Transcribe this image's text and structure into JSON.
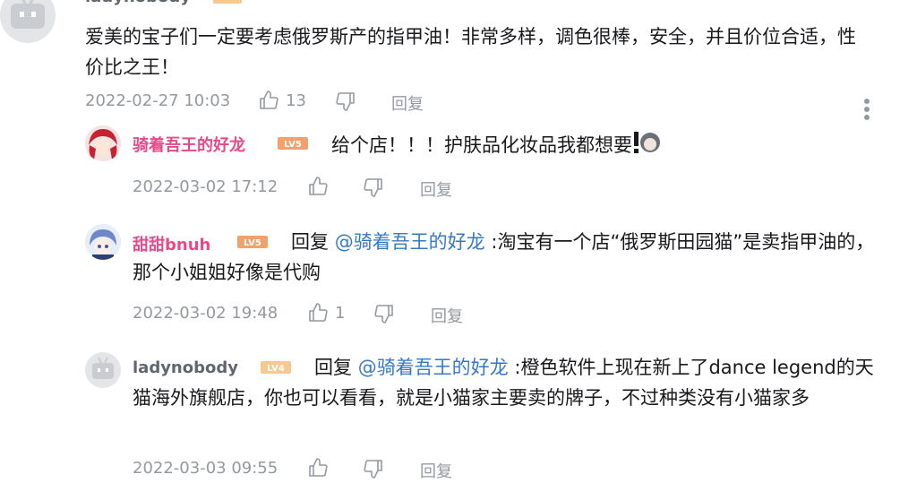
{
  "colors": {
    "username_pink": "#e8498a",
    "username_default": "#61666d",
    "mention_blue": "#3578c5",
    "meta_gray": "#9499a0",
    "level_orange": "#f2a16c",
    "level_light": "#f7c88f"
  },
  "main": {
    "username": "ladynobody",
    "text": "爱美的宝子们一定要考虑俄罗斯产的指甲油！非常多样，调色很棒，安全，并且价位合适，性价比之王！",
    "time": "2022-02-27 10:03",
    "likes": "13",
    "reply_label": "回复",
    "more_icon": "more-vertical-icon"
  },
  "replies": [
    {
      "username": "骑着吾王的好龙",
      "level": "LV5",
      "text": "给个店！！！护肤品化妆品我都想要",
      "time": "2022-03-02 17:12",
      "likes": "",
      "reply_label": "回复"
    },
    {
      "username": "甜甜bnuh",
      "level": "LV5",
      "reply_prefix": "回复",
      "mention": "@骑着吾王的好龙",
      "text": ":淘宝有一个店“俄罗斯田园猫”是卖指甲油的，那个小姐姐好像是代购",
      "time": "2022-03-02 19:48",
      "likes": "1",
      "reply_label": "回复"
    },
    {
      "username": "ladynobody",
      "level": "LV4",
      "reply_prefix": "回复",
      "mention": "@骑着吾王的好龙",
      "text": ":橙色软件上现在新上了dance legend的天猫海外旗舰店，你也可以看看，就是小猫家主要卖的牌子，不过种类没有小猫家多",
      "time": "2022-03-03 09:55",
      "likes": "",
      "reply_label": "回复"
    }
  ]
}
